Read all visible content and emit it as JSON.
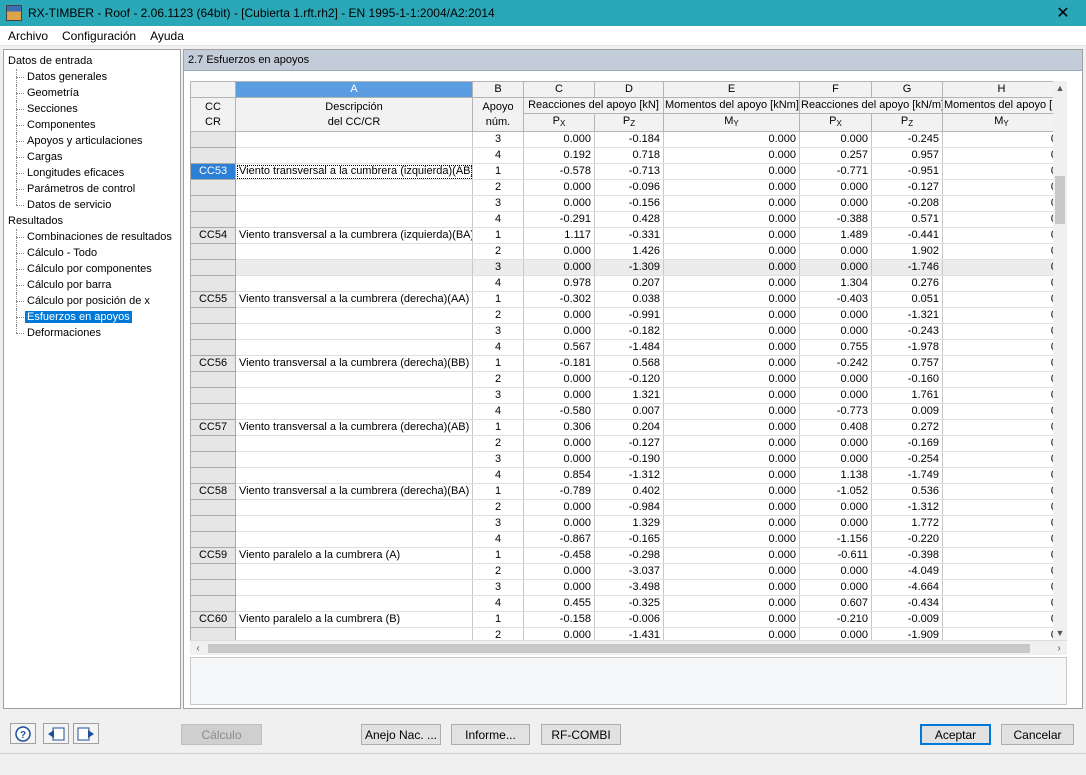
{
  "window": {
    "title": "RX-TIMBER - Roof - 2.06.1123 (64bit) - [Cubierta 1.rft.rh2] - EN 1995-1-1:2004/A2:2014",
    "close_glyph": "✕"
  },
  "menu": {
    "items": [
      "Archivo",
      "Configuración",
      "Ayuda"
    ]
  },
  "tree": {
    "input_group": "Datos de entrada",
    "input_items": [
      "Datos generales",
      "Geometría",
      "Secciones",
      "Componentes",
      "Apoyos y articulaciones",
      "Cargas",
      "Longitudes eficaces",
      "Parámetros de control",
      "Datos de servicio"
    ],
    "results_group": "Resultados",
    "result_items": [
      "Combinaciones de resultados",
      "Cálculo - Todo",
      "Cálculo por componentes",
      "Cálculo por barra",
      "Cálculo por posición de x",
      "Esfuerzos en apoyos",
      "Deformaciones"
    ],
    "selected": "Esfuerzos en apoyos"
  },
  "panel": {
    "title": "2.7 Esfuerzos en apoyos"
  },
  "table": {
    "column_letters": [
      "A",
      "B",
      "C",
      "D",
      "E",
      "F",
      "G",
      "H"
    ],
    "header": {
      "cc_line1": "CC",
      "cc_line2": "CR",
      "desc_line1": "Descripción",
      "desc_line2": "del CC/CR",
      "support_line1": "Apoyo",
      "support_line2": "núm.",
      "reactions": "Reacciones del apoyo [kN]",
      "moments": "Momentos del apoyo [kNm]",
      "reactions_per_m": "Reacciones del apoyo [kN/m]",
      "moments_per_m": "Momentos del apoyo [kN",
      "px_main": "P",
      "px_sub": "X",
      "pz_main": "P",
      "pz_sub": "Z",
      "my_main": "M",
      "my_sub": "Y"
    },
    "rows": [
      {
        "cc": "",
        "desc": "",
        "apoyo": "3",
        "c": "0.000",
        "d": "-0.184",
        "e": "0.000",
        "f": "0.000",
        "g": "-0.245",
        "h": "0"
      },
      {
        "cc": "",
        "desc": "",
        "apoyo": "4",
        "c": "0.192",
        "d": "0.718",
        "e": "0.000",
        "f": "0.257",
        "g": "0.957",
        "h": "0"
      },
      {
        "cc": "CC53",
        "desc": "Viento transversal a la cumbrera (izquierda)(AB)",
        "apoyo": "1",
        "c": "-0.578",
        "d": "-0.713",
        "e": "0.000",
        "f": "-0.771",
        "g": "-0.951",
        "h": "0"
      },
      {
        "cc": "",
        "desc": "",
        "apoyo": "2",
        "c": "0.000",
        "d": "-0.096",
        "e": "0.000",
        "f": "0.000",
        "g": "-0.127",
        "h": "0"
      },
      {
        "cc": "",
        "desc": "",
        "apoyo": "3",
        "c": "0.000",
        "d": "-0.156",
        "e": "0.000",
        "f": "0.000",
        "g": "-0.208",
        "h": "0"
      },
      {
        "cc": "",
        "desc": "",
        "apoyo": "4",
        "c": "-0.291",
        "d": "0.428",
        "e": "0.000",
        "f": "-0.388",
        "g": "0.571",
        "h": "0"
      },
      {
        "cc": "CC54",
        "desc": "Viento transversal a la cumbrera (izquierda)(BA)",
        "apoyo": "1",
        "c": "1.117",
        "d": "-0.331",
        "e": "0.000",
        "f": "1.489",
        "g": "-0.441",
        "h": "0"
      },
      {
        "cc": "",
        "desc": "",
        "apoyo": "2",
        "c": "0.000",
        "d": "1.426",
        "e": "0.000",
        "f": "0.000",
        "g": "1.902",
        "h": "0"
      },
      {
        "cc": "",
        "desc": "",
        "apoyo": "3",
        "c": "0.000",
        "d": "-1.309",
        "e": "0.000",
        "f": "0.000",
        "g": "-1.746",
        "h": "0"
      },
      {
        "cc": "",
        "desc": "",
        "apoyo": "4",
        "c": "0.978",
        "d": "0.207",
        "e": "0.000",
        "f": "1.304",
        "g": "0.276",
        "h": "0"
      },
      {
        "cc": "CC55",
        "desc": "Viento transversal a la cumbrera (derecha)(AA)",
        "apoyo": "1",
        "c": "-0.302",
        "d": "0.038",
        "e": "0.000",
        "f": "-0.403",
        "g": "0.051",
        "h": "0"
      },
      {
        "cc": "",
        "desc": "",
        "apoyo": "2",
        "c": "0.000",
        "d": "-0.991",
        "e": "0.000",
        "f": "0.000",
        "g": "-1.321",
        "h": "0"
      },
      {
        "cc": "",
        "desc": "",
        "apoyo": "3",
        "c": "0.000",
        "d": "-0.182",
        "e": "0.000",
        "f": "0.000",
        "g": "-0.243",
        "h": "0"
      },
      {
        "cc": "",
        "desc": "",
        "apoyo": "4",
        "c": "0.567",
        "d": "-1.484",
        "e": "0.000",
        "f": "0.755",
        "g": "-1.978",
        "h": "0"
      },
      {
        "cc": "CC56",
        "desc": "Viento transversal a la cumbrera (derecha)(BB)",
        "apoyo": "1",
        "c": "-0.181",
        "d": "0.568",
        "e": "0.000",
        "f": "-0.242",
        "g": "0.757",
        "h": "0"
      },
      {
        "cc": "",
        "desc": "",
        "apoyo": "2",
        "c": "0.000",
        "d": "-0.120",
        "e": "0.000",
        "f": "0.000",
        "g": "-0.160",
        "h": "0"
      },
      {
        "cc": "",
        "desc": "",
        "apoyo": "3",
        "c": "0.000",
        "d": "1.321",
        "e": "0.000",
        "f": "0.000",
        "g": "1.761",
        "h": "0"
      },
      {
        "cc": "",
        "desc": "",
        "apoyo": "4",
        "c": "-0.580",
        "d": "0.007",
        "e": "0.000",
        "f": "-0.773",
        "g": "0.009",
        "h": "0"
      },
      {
        "cc": "CC57",
        "desc": "Viento transversal a la cumbrera (derecha)(AB)",
        "apoyo": "1",
        "c": "0.306",
        "d": "0.204",
        "e": "0.000",
        "f": "0.408",
        "g": "0.272",
        "h": "0"
      },
      {
        "cc": "",
        "desc": "",
        "apoyo": "2",
        "c": "0.000",
        "d": "-0.127",
        "e": "0.000",
        "f": "0.000",
        "g": "-0.169",
        "h": "0"
      },
      {
        "cc": "",
        "desc": "",
        "apoyo": "3",
        "c": "0.000",
        "d": "-0.190",
        "e": "0.000",
        "f": "0.000",
        "g": "-0.254",
        "h": "0"
      },
      {
        "cc": "",
        "desc": "",
        "apoyo": "4",
        "c": "0.854",
        "d": "-1.312",
        "e": "0.000",
        "f": "1.138",
        "g": "-1.749",
        "h": "0"
      },
      {
        "cc": "CC58",
        "desc": "Viento transversal a la cumbrera (derecha)(BA)",
        "apoyo": "1",
        "c": "-0.789",
        "d": "0.402",
        "e": "0.000",
        "f": "-1.052",
        "g": "0.536",
        "h": "0"
      },
      {
        "cc": "",
        "desc": "",
        "apoyo": "2",
        "c": "0.000",
        "d": "-0.984",
        "e": "0.000",
        "f": "0.000",
        "g": "-1.312",
        "h": "0"
      },
      {
        "cc": "",
        "desc": "",
        "apoyo": "3",
        "c": "0.000",
        "d": "1.329",
        "e": "0.000",
        "f": "0.000",
        "g": "1.772",
        "h": "0"
      },
      {
        "cc": "",
        "desc": "",
        "apoyo": "4",
        "c": "-0.867",
        "d": "-0.165",
        "e": "0.000",
        "f": "-1.156",
        "g": "-0.220",
        "h": "0"
      },
      {
        "cc": "CC59",
        "desc": "Viento paralelo a la cumbrera (A)",
        "apoyo": "1",
        "c": "-0.458",
        "d": "-0.298",
        "e": "0.000",
        "f": "-0.611",
        "g": "-0.398",
        "h": "0"
      },
      {
        "cc": "",
        "desc": "",
        "apoyo": "2",
        "c": "0.000",
        "d": "-3.037",
        "e": "0.000",
        "f": "0.000",
        "g": "-4.049",
        "h": "0"
      },
      {
        "cc": "",
        "desc": "",
        "apoyo": "3",
        "c": "0.000",
        "d": "-3.498",
        "e": "0.000",
        "f": "0.000",
        "g": "-4.664",
        "h": "0"
      },
      {
        "cc": "",
        "desc": "",
        "apoyo": "4",
        "c": "0.455",
        "d": "-0.325",
        "e": "0.000",
        "f": "0.607",
        "g": "-0.434",
        "h": "0"
      },
      {
        "cc": "CC60",
        "desc": "Viento paralelo a la cumbrera (B)",
        "apoyo": "1",
        "c": "-0.158",
        "d": "-0.006",
        "e": "0.000",
        "f": "-0.210",
        "g": "-0.009",
        "h": "0"
      },
      {
        "cc": "",
        "desc": "",
        "apoyo": "2",
        "c": "0.000",
        "d": "-1.431",
        "e": "0.000",
        "f": "0.000",
        "g": "-1.909",
        "h": "0"
      }
    ],
    "selected_cc": "CC53",
    "highlight_row_index": 8
  },
  "buttons": {
    "calc": "Cálculo",
    "anejo": "Anejo Nac. ...",
    "informe": "Informe...",
    "rfcombi": "RF-COMBI",
    "aceptar": "Aceptar",
    "cancelar": "Cancelar"
  },
  "icons": {
    "help": "help-icon",
    "prev": "previous-table-icon",
    "next": "next-table-icon"
  },
  "colors": {
    "titlebar": "#2aa8b8",
    "selection": "#0078d7",
    "panel_title": "#c2cdd9"
  }
}
